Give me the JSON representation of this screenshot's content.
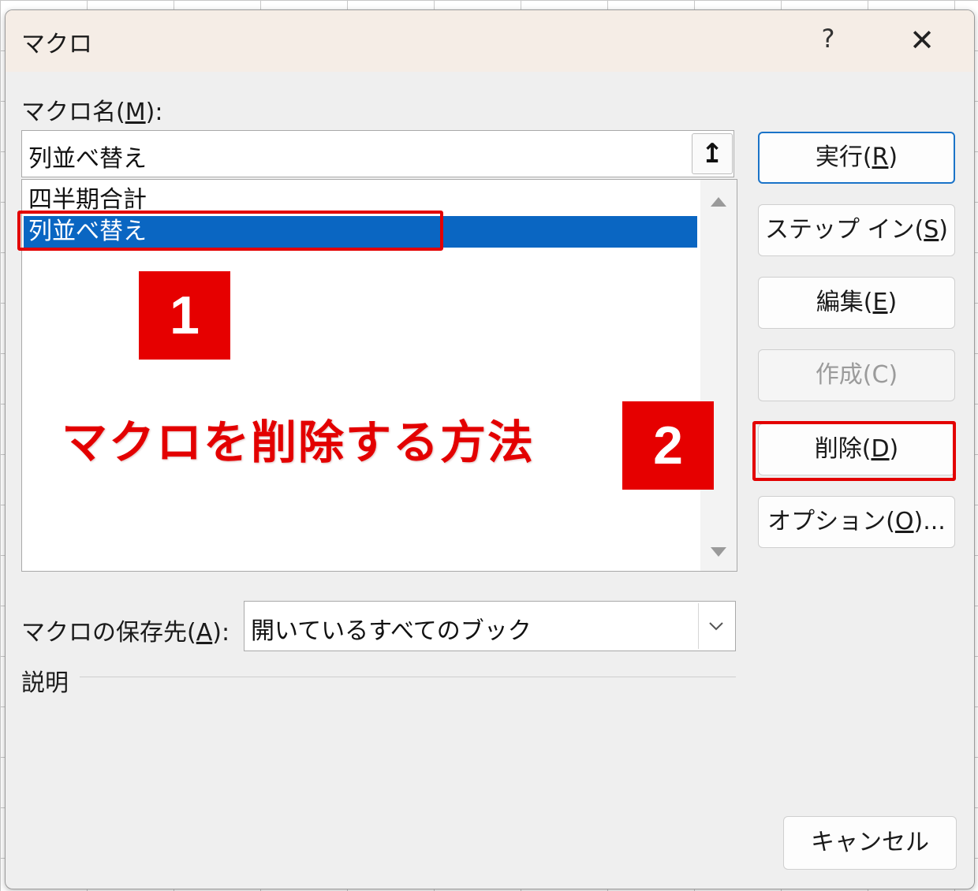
{
  "dialog": {
    "title": "マクロ",
    "help": "?",
    "close": "✕"
  },
  "macro_name": {
    "label_prefix": "マクロ名(",
    "label_key": "M",
    "label_suffix": "):",
    "value": "列並べ替え",
    "ref_icon": "↥"
  },
  "macro_list": {
    "items": [
      "四半期合計",
      "列並べ替え"
    ],
    "selected": "列並べ替え"
  },
  "buttons": {
    "run": {
      "prefix": "実行(",
      "key": "R",
      "suffix": ")"
    },
    "step_in": {
      "prefix": "ステップ イン(",
      "key": "S",
      "suffix": ")"
    },
    "edit": {
      "prefix": "編集(",
      "key": "E",
      "suffix": ")"
    },
    "create": "作成(C)",
    "delete": {
      "prefix": "削除(",
      "key": "D",
      "suffix": ")"
    },
    "options": {
      "prefix": "オプション(",
      "key": "O",
      "suffix": ")..."
    },
    "cancel": "キャンセル"
  },
  "store_in": {
    "label_prefix": "マクロの保存先(",
    "label_key": "A",
    "label_suffix": "):",
    "value": "開いているすべてのブック"
  },
  "description_label": "説明",
  "annotations": {
    "step1": "1",
    "step2": "2",
    "caption": "マクロを削除する方法",
    "highlight_color": "#e30000"
  }
}
